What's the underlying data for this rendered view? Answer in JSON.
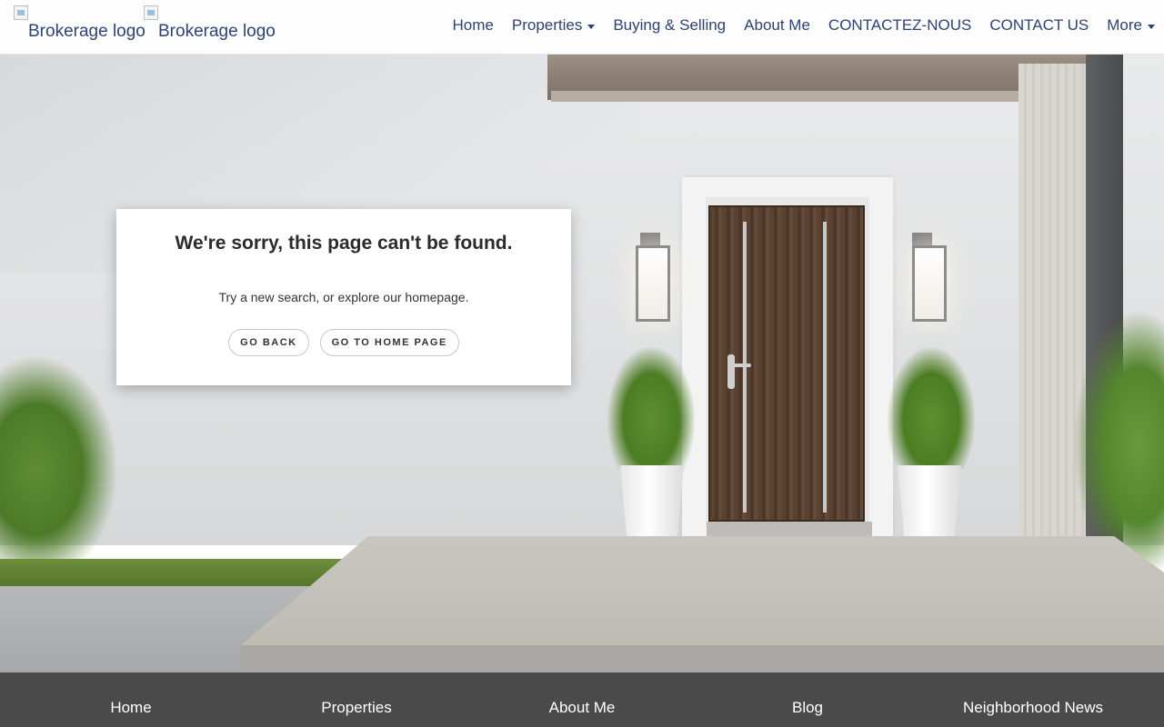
{
  "header": {
    "logos": [
      {
        "alt": "Brokerage logo"
      },
      {
        "alt": "Brokerage logo"
      }
    ],
    "nav": [
      {
        "label": "Home",
        "has_dropdown": false
      },
      {
        "label": "Properties",
        "has_dropdown": true
      },
      {
        "label": "Buying & Selling",
        "has_dropdown": false
      },
      {
        "label": "About Me",
        "has_dropdown": false
      },
      {
        "label": "CONTACTEZ-NOUS",
        "has_dropdown": false
      },
      {
        "label": "CONTACT US",
        "has_dropdown": false
      },
      {
        "label": "More",
        "has_dropdown": true
      }
    ]
  },
  "error_card": {
    "title": "We're sorry, this page can't be found.",
    "message": "Try a new search, or explore our homepage.",
    "buttons": {
      "back": "GO BACK",
      "home": "GO TO HOME PAGE"
    }
  },
  "footer": {
    "links": [
      "Home",
      "Properties",
      "About Me",
      "Blog",
      "Neighborhood News"
    ]
  },
  "colors": {
    "nav_text": "#2d4373",
    "footer_bg": "#4a4a4a",
    "footer_text": "#ffffff",
    "card_bg": "#ffffff"
  },
  "icons": {
    "logo": "broken-image-icon",
    "dropdown": "caret-down-icon"
  }
}
